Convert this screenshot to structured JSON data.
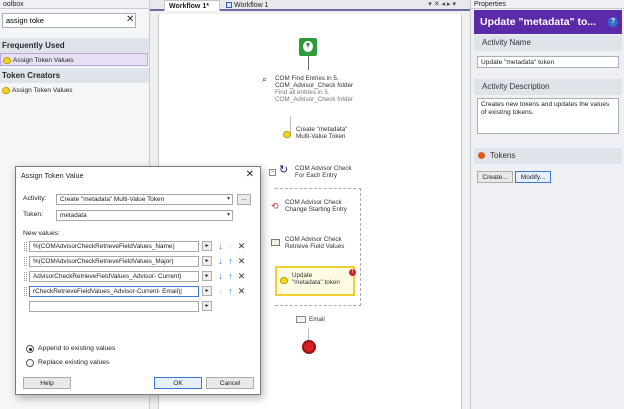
{
  "toolbox": {
    "title": "oolbox",
    "search_value": "assign toke",
    "groups": [
      {
        "header": "Frequently Used",
        "items": [
          "Assign Token Values"
        ]
      },
      {
        "header": "Token Creators",
        "items": [
          "Assign Token Values"
        ]
      }
    ]
  },
  "document": {
    "tabs": [
      "Workflow 1*",
      "Workflow 1"
    ],
    "tab_icons": "▾ ✕ ◂ ▸ ▾",
    "steps": [
      {
        "label": "COM Find Entries in 5.",
        "label2": "COM_Advisor_Check folder",
        "sub": "Find all entries in 5.",
        "sub2": "COM_Advisor_Check folder"
      },
      {
        "label": "Create \"metadata\"",
        "label2": "Multi-Value Token"
      },
      {
        "label": "COM Advisor Check",
        "label2": "For Each Entry"
      },
      {
        "label": "COM Advisor Check",
        "label2": "Change Starting Entry"
      },
      {
        "label": "COM Advisor Check",
        "label2": "Retrieve Field Values"
      },
      {
        "label": "Update",
        "label2": "\"metadata\" token"
      },
      {
        "label": "Email"
      }
    ]
  },
  "properties": {
    "title": "Properties",
    "header": "Update \"metadata\" to...",
    "activity_name_label": "Activity Name",
    "activity_name_value": "Update \"metadata\" token",
    "activity_desc_label": "Activity Description",
    "activity_desc_value": "Creates new tokens and updates the values of existing tokens.",
    "tokens_label": "Tokens",
    "create_btn": "Create...",
    "modify_btn": "Modify..."
  },
  "dialog": {
    "title": "Assign Token Value",
    "activity_label": "Activity:",
    "activity_value": "Create \"metadata\" Multi-Value Token",
    "browse_btn": "...",
    "token_label": "Token:",
    "token_value": "metadata",
    "new_values_label": "New values:",
    "values": [
      "%(COMAdvisorCheckRetrieveFieldValues_Name)",
      "%(COMAdvisorCheckRetrieveFieldValues_Major)",
      "AdvisorCheckRetrieveFieldValues_Advisor- Current)",
      "rCheckRetrieveFieldValues_Advisor-Current- Email)|"
    ],
    "append_label": "Append to existing values",
    "replace_label": "Replace existing values",
    "help_btn": "Help",
    "ok_btn": "OK",
    "cancel_btn": "Cancel"
  },
  "colors": {
    "accent": "#5b2aa8",
    "start_green": "#2e9a3a",
    "stop_red": "#d42020"
  }
}
